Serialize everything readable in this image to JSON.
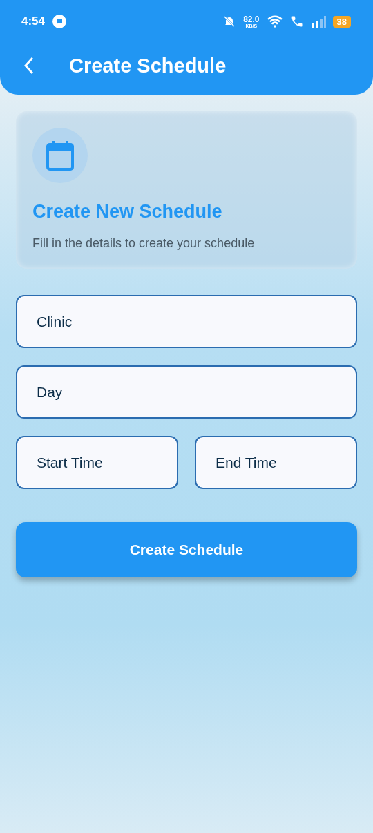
{
  "status_bar": {
    "time": "4:54",
    "speed": "82.0",
    "speed_unit": "KB/S",
    "battery": "38"
  },
  "header": {
    "title": "Create Schedule"
  },
  "intro_card": {
    "title": "Create New Schedule",
    "subtitle": "Fill in the details to create your schedule"
  },
  "fields": [
    {
      "placeholder": "Clinic"
    },
    {
      "placeholder": "Day"
    }
  ],
  "time_fields": [
    {
      "placeholder": "Start Time"
    },
    {
      "placeholder": "End Time"
    }
  ],
  "submit_button": {
    "label": "Create Schedule"
  }
}
